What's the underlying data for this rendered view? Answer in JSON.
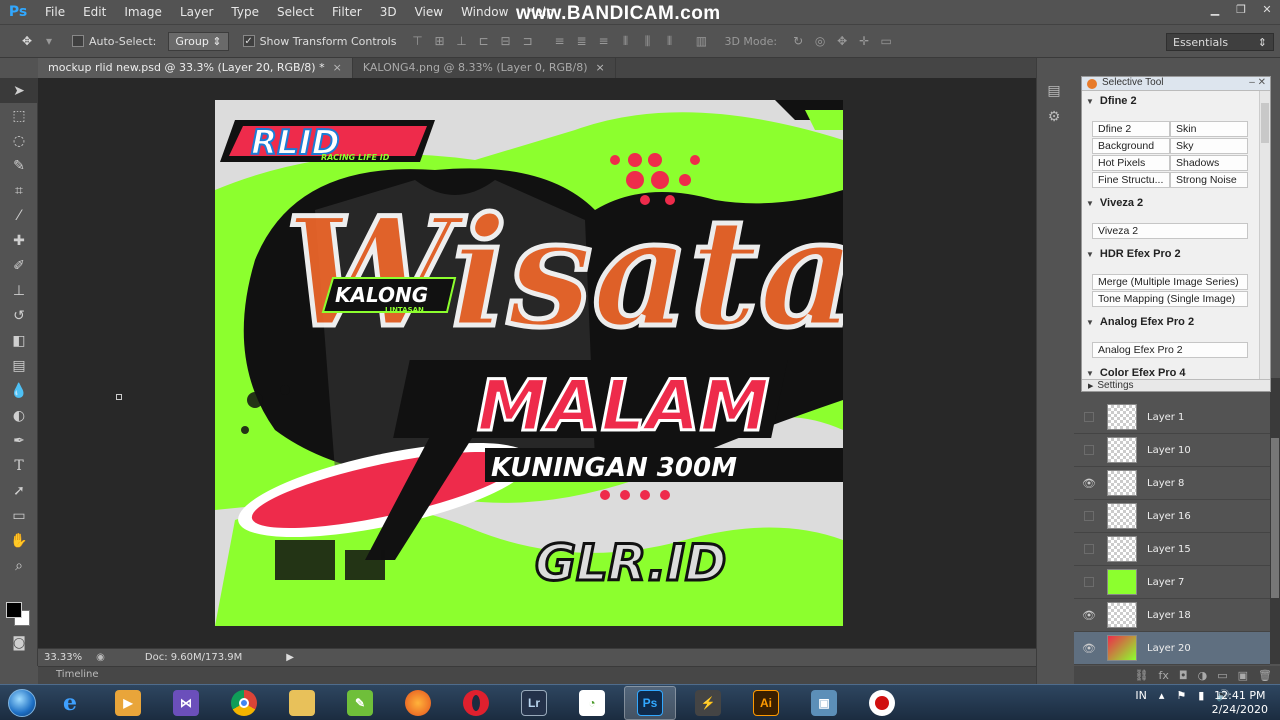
{
  "app": {
    "logo": "Ps",
    "watermark": "www.BANDICAM.com",
    "menu": [
      "File",
      "Edit",
      "Image",
      "Layer",
      "Type",
      "Select",
      "Filter",
      "3D",
      "View",
      "Window",
      "Help"
    ]
  },
  "options": {
    "auto_select_label": "Auto-Select:",
    "auto_select_value": "Group",
    "transform_label": "Show Transform Controls",
    "mode_label": "3D Mode:",
    "workspace": "Essentials"
  },
  "tabs": [
    {
      "label": "mockup rlid new.psd @ 33.3% (Layer 20, RGB/8) *",
      "close": "×",
      "active": true
    },
    {
      "label": "KALONG4.png @ 8.33% (Layer 0, RGB/8)",
      "close": "×",
      "active": false
    }
  ],
  "status": {
    "zoom": "33.33%",
    "doc": "Doc: 9.60M/173.9M"
  },
  "timeline_label": "Timeline",
  "artwork_text": {
    "brand": "RLID",
    "brand_sub": "RACING LIFE ID",
    "headline": "Wisata",
    "headline2": "MALAM",
    "subline": "KUNINGAN 300M",
    "badge": "KALONG",
    "badge_sub": "LINTASAN",
    "bottom": "GLR.ID"
  },
  "selective_tool": {
    "title": "Selective Tool",
    "sections": [
      {
        "name": "Dfine 2",
        "buttons": [
          "Dfine 2",
          "Skin",
          "Background",
          "Sky",
          "Hot Pixels",
          "Shadows",
          "Fine Structu...",
          "Strong Noise"
        ]
      },
      {
        "name": "Viveza 2",
        "buttons": [
          "Viveza 2"
        ]
      },
      {
        "name": "HDR Efex Pro 2",
        "buttons": [
          "Merge (Multiple Image Series)",
          "Tone Mapping (Single Image)"
        ]
      },
      {
        "name": "Analog Efex Pro 2",
        "buttons": [
          "Analog Efex Pro 2"
        ]
      },
      {
        "name": "Color Efex Pro 4",
        "buttons": []
      }
    ],
    "footer": "Settings"
  },
  "layers": [
    {
      "name": "Layer 1",
      "visible": false
    },
    {
      "name": "Layer 10",
      "visible": false
    },
    {
      "name": "Layer 8",
      "visible": true
    },
    {
      "name": "Layer 16",
      "visible": false
    },
    {
      "name": "Layer 15",
      "visible": false
    },
    {
      "name": "Layer 7",
      "visible": false
    },
    {
      "name": "Layer 18",
      "visible": true
    },
    {
      "name": "Layer 20",
      "visible": true,
      "selected": true
    }
  ],
  "taskbar": {
    "lr_label": "Lr",
    "ps_label": "Ps",
    "ai_label": "Ai",
    "lang": "IN",
    "time": "12:41 PM",
    "date": "2/24/2020"
  },
  "colors": {
    "lime": "#8cff2e",
    "orange": "#f0672b",
    "red": "#ee2b4b",
    "black": "#111111"
  }
}
